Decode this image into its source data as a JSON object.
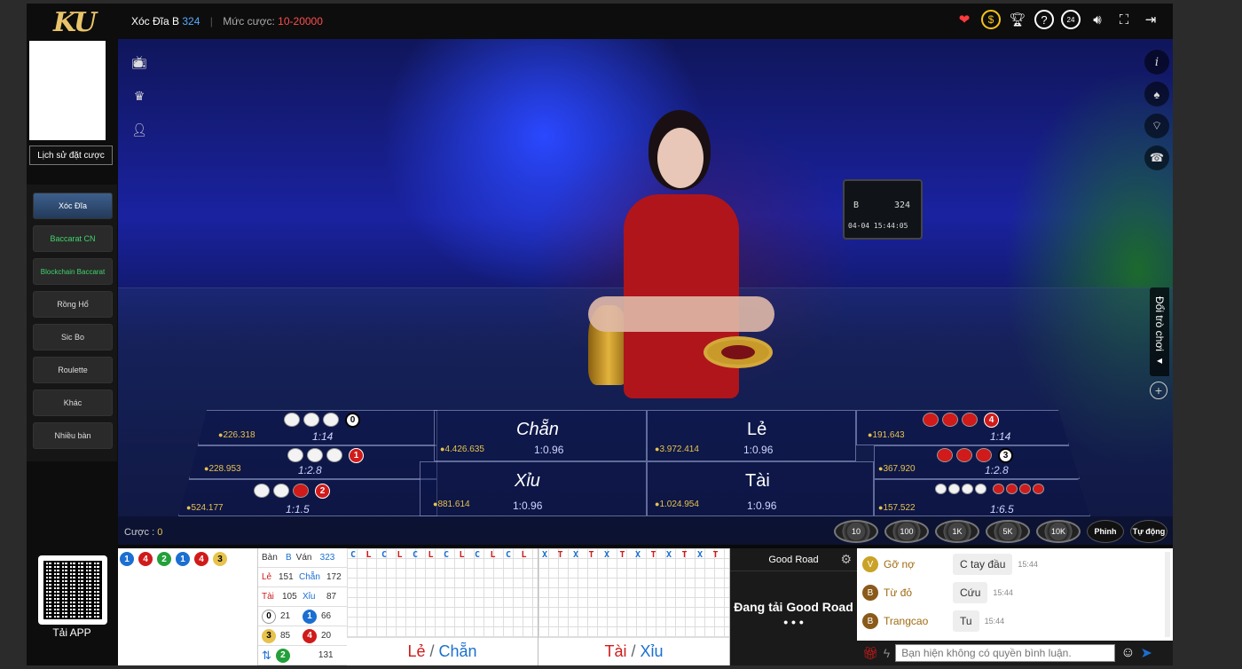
{
  "header": {
    "logo_a": "K",
    "logo_b": "U",
    "table_label": "Xóc Đĩa B",
    "table_number": "324",
    "bet_range_label": "Mức cược:",
    "bet_range_value": "10-20000",
    "icons": [
      "favorite-icon",
      "cash-icon",
      "trophy-icon",
      "help-icon",
      "support-24-icon",
      "sound-icon",
      "fullscreen-icon",
      "exit-icon"
    ]
  },
  "sidebar": {
    "history_label": "Lịch sử đặt cược",
    "games": [
      {
        "label": "Xóc Đĩa"
      },
      {
        "label": "Baccarat CN"
      },
      {
        "label": "Blockchain Baccarat"
      },
      {
        "label": "Rồng Hổ"
      },
      {
        "label": "Sic Bo"
      },
      {
        "label": "Roulette"
      },
      {
        "label": "Khác"
      },
      {
        "label": "Nhiều bàn"
      }
    ],
    "app_label": "Tải APP"
  },
  "video": {
    "monitor_table": "B",
    "monitor_round": "324",
    "monitor_time": "04-04 15:44:05",
    "switch_game_label": "Đổi trò chơi ◂"
  },
  "bets": {
    "left": [
      {
        "amount": "226.318",
        "ratio": "1:14"
      },
      {
        "amount": "228.953",
        "ratio": "1:2.8"
      },
      {
        "amount": "524.177",
        "ratio": "1:1.5"
      }
    ],
    "center": [
      {
        "name": "Chẵn",
        "amount": "4.426.635",
        "ratio": "1:0.96"
      },
      {
        "name": "Lẻ",
        "amount": "3.972.414",
        "ratio": "1:0.96"
      },
      {
        "name": "Xỉu",
        "amount": "881.614",
        "ratio": "1:0.96"
      },
      {
        "name": "Tài",
        "amount": "1.024.954",
        "ratio": "1:0.96"
      }
    ],
    "right": [
      {
        "amount": "191.643",
        "ratio": "1:14"
      },
      {
        "amount": "367.920",
        "ratio": "1:2.8"
      },
      {
        "amount": "157.522",
        "ratio": "1:6.5"
      }
    ],
    "badges": {
      "l1": "0",
      "l2": "1",
      "l3": "2",
      "r1": "4",
      "r2": "3"
    }
  },
  "betbar": {
    "bet_label": "Cược :",
    "bet_value": "0",
    "chips": [
      "10",
      "100",
      "1K",
      "5K",
      "10K"
    ],
    "actions": [
      "Phỉnh",
      "Tự động"
    ]
  },
  "stats": {
    "balls": [
      {
        "v": "1",
        "c": "b"
      },
      {
        "v": "4",
        "c": "r"
      },
      {
        "v": "2",
        "c": "g"
      },
      {
        "v": "1",
        "c": "b"
      },
      {
        "v": "4",
        "c": "r"
      },
      {
        "v": "3",
        "c": "y"
      }
    ],
    "rows": [
      {
        "a": "Bàn",
        "b": "B",
        "c": "Ván",
        "d": "323"
      },
      {
        "a": "Lẻ",
        "b": "151",
        "c": "Chẵn",
        "d": "172"
      },
      {
        "a": "Tài",
        "b": "105",
        "c": "Xỉu",
        "d": "87"
      },
      {
        "a": "0",
        "b": "21",
        "c": "1",
        "d": "66"
      },
      {
        "a": "3",
        "b": "85",
        "c": "4",
        "d": "20"
      },
      {
        "a": "2",
        "b": "",
        "c": "",
        "d": "131"
      }
    ]
  },
  "roads": {
    "odd_even_title_a": "Lẻ",
    "odd_even_title_b": "Chẵn",
    "big_small_title_a": "Tài",
    "big_small_title_b": "Xỉu",
    "road1_top": [
      "C",
      "L",
      "C",
      "L",
      "C",
      "L",
      "C",
      "L",
      "C",
      "L",
      "C",
      "L"
    ],
    "road2_top": [
      "X",
      "T",
      "X",
      "T",
      "X",
      "T",
      "X",
      "T",
      "X",
      "T",
      "X",
      "T"
    ]
  },
  "goodroad": {
    "title": "Good Road",
    "loading": "Đang tải Good Road",
    "dots": "• • •"
  },
  "chat": {
    "messages": [
      {
        "avatar": "V",
        "user": "Gỡ nợ",
        "text": "C tay đầu",
        "time": "15:44"
      },
      {
        "avatar": "B",
        "user": "Từ đỏ",
        "text": "Cứu",
        "time": "15:44"
      },
      {
        "avatar": "B",
        "user": "Trangcao",
        "text": "Tu",
        "time": "15:44"
      }
    ],
    "placeholder": "Bạn hiện không có quyền bình luận."
  },
  "colors": {
    "accent": "#2aa3ff",
    "gold": "#e7c24d",
    "red": "#d11a1a",
    "blue": "#1b6fd1"
  }
}
